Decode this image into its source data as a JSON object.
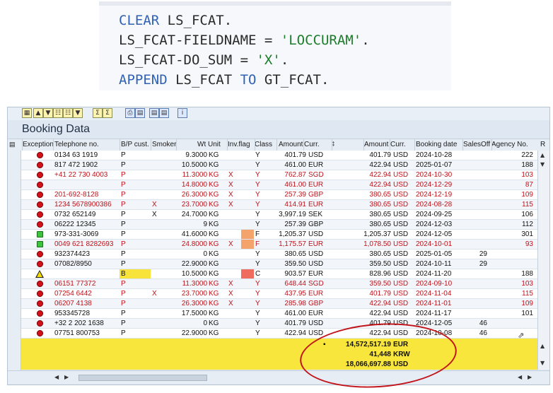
{
  "code": {
    "lines": [
      {
        "a": "CLEAR",
        "b": " LS_FCAT."
      },
      {
        "a": "LS_FCAT-FIELDNAME",
        "b": " = ",
        "c": "'LOCCURAM'",
        "d": "."
      },
      {
        "a": "LS_FCAT-DO_SUM",
        "b": " = ",
        "c": "'X'",
        "d": "."
      },
      {
        "a": "APPEND",
        "b": " LS_FCAT ",
        "c": "TO",
        "d": " GT_FCAT."
      }
    ]
  },
  "alv": {
    "title": "Booking Data",
    "toolbar_icons": [
      "details-icon",
      "sort-ascending-icon",
      "sort-descending-icon",
      "find-icon",
      "find-next-icon",
      "filter-icon",
      "sum-icon",
      "subtotal-icon",
      "print-icon",
      "views-icon",
      "export-icon",
      "layout-icon",
      "info-icon"
    ],
    "headers": [
      "Exception",
      "Telephone no.",
      "B/P cust.",
      "Smoker",
      "Wt Unit",
      "Inv.flag",
      "Class",
      "Amount",
      "Curr.",
      "Amount",
      "Curr.",
      "Booking date",
      "SalesOff",
      "Agency No.",
      "R"
    ],
    "rows": [
      {
        "exc": "red",
        "tel": "0134 63 1919",
        "bp": "P",
        "smk": "",
        "wt": "9.3000",
        "unit": "KG",
        "inv": "",
        "cls": "Y",
        "amt": "401.79",
        "cur": "USD",
        "lamt": "401.79",
        "lcur": "USD",
        "date": "2024-10-28",
        "so": "",
        "ag": "222",
        "red": false
      },
      {
        "exc": "red",
        "tel": "817 472 1902",
        "bp": "P",
        "smk": "",
        "wt": "10.5000",
        "unit": "KG",
        "inv": "",
        "cls": "Y",
        "amt": "461.00",
        "cur": "EUR",
        "lamt": "422.94",
        "lcur": "USD",
        "date": "2025-01-07",
        "so": "",
        "ag": "188",
        "red": false
      },
      {
        "exc": "red",
        "tel": "+41 22 730 4003",
        "bp": "P",
        "smk": "",
        "wt": "11.3000",
        "unit": "KG",
        "inv": "X",
        "cls": "Y",
        "amt": "762.87",
        "cur": "SGD",
        "lamt": "422.94",
        "lcur": "USD",
        "date": "2024-10-30",
        "so": "",
        "ag": "103",
        "red": true
      },
      {
        "exc": "red",
        "tel": "",
        "bp": "P",
        "smk": "",
        "wt": "14.8000",
        "unit": "KG",
        "inv": "X",
        "cls": "Y",
        "amt": "461.00",
        "cur": "EUR",
        "lamt": "422.94",
        "lcur": "USD",
        "date": "2024-12-29",
        "so": "",
        "ag": "87",
        "red": true
      },
      {
        "exc": "red",
        "tel": "201-692-8128",
        "bp": "P",
        "smk": "",
        "wt": "26.3000",
        "unit": "KG",
        "inv": "X",
        "cls": "Y",
        "amt": "257.39",
        "cur": "GBP",
        "lamt": "380.65",
        "lcur": "USD",
        "date": "2024-12-19",
        "so": "",
        "ag": "109",
        "red": true
      },
      {
        "exc": "red",
        "tel": "1234 5678900386",
        "bp": "P",
        "smk": "X",
        "wt": "23.7000",
        "unit": "KG",
        "inv": "X",
        "cls": "Y",
        "amt": "414.91",
        "cur": "EUR",
        "lamt": "380.65",
        "lcur": "USD",
        "date": "2024-08-28",
        "so": "",
        "ag": "115",
        "red": true
      },
      {
        "exc": "red",
        "tel": "0732 652149",
        "bp": "P",
        "smk": "X",
        "wt": "24.7000",
        "unit": "KG",
        "inv": "",
        "cls": "Y",
        "amt": "3,997.19",
        "cur": "SEK",
        "lamt": "380.65",
        "lcur": "USD",
        "date": "2024-09-25",
        "so": "",
        "ag": "106",
        "red": false
      },
      {
        "exc": "red",
        "tel": "06222 12345",
        "bp": "P",
        "smk": "",
        "wt": "9",
        "unit": "KG",
        "inv": "",
        "cls": "Y",
        "amt": "257.39",
        "cur": "GBP",
        "lamt": "380.65",
        "lcur": "USD",
        "date": "2024-12-03",
        "so": "",
        "ag": "112",
        "red": false
      },
      {
        "exc": "green",
        "tel": "973-331-3069",
        "bp": "P",
        "smk": "",
        "wt": "41.6000",
        "unit": "KG",
        "inv": "",
        "cls": "F",
        "amt": "1,205.37",
        "cur": "USD",
        "lamt": "1,205.37",
        "lcur": "USD",
        "date": "2024-12-05",
        "so": "",
        "ag": "301",
        "red": false,
        "clsbg": "#f4a46a"
      },
      {
        "exc": "green",
        "tel": "0049 621 8282693",
        "bp": "P",
        "smk": "",
        "wt": "24.8000",
        "unit": "KG",
        "inv": "X",
        "cls": "F",
        "amt": "1,175.57",
        "cur": "EUR",
        "lamt": "1,078.50",
        "lcur": "USD",
        "date": "2024-10-01",
        "so": "",
        "ag": "93",
        "red": true,
        "clsbg": "#f4a46a"
      },
      {
        "exc": "red",
        "tel": "932374423",
        "bp": "P",
        "smk": "",
        "wt": "0",
        "unit": "KG",
        "inv": "",
        "cls": "Y",
        "amt": "380.65",
        "cur": "USD",
        "lamt": "380.65",
        "lcur": "USD",
        "date": "2025-01-05",
        "so": "29",
        "ag": "",
        "red": false
      },
      {
        "exc": "red",
        "tel": "07082/8950",
        "bp": "P",
        "smk": "",
        "wt": "22.9000",
        "unit": "KG",
        "inv": "",
        "cls": "Y",
        "amt": "359.50",
        "cur": "USD",
        "lamt": "359.50",
        "lcur": "USD",
        "date": "2024-10-11",
        "so": "29",
        "ag": "",
        "red": false
      },
      {
        "exc": "warn",
        "tel": "",
        "bp": "B",
        "smk": "",
        "wt": "10.5000",
        "unit": "KG",
        "inv": "",
        "cls": "C",
        "amt": "903.57",
        "cur": "EUR",
        "lamt": "828.96",
        "lcur": "USD",
        "date": "2024-11-20",
        "so": "",
        "ag": "188",
        "red": false,
        "bpbg": "#f7e33a",
        "clsbg": "#f06c5e"
      },
      {
        "exc": "red",
        "tel": "06151 77372",
        "bp": "P",
        "smk": "",
        "wt": "11.3000",
        "unit": "KG",
        "inv": "X",
        "cls": "Y",
        "amt": "648.44",
        "cur": "SGD",
        "lamt": "359.50",
        "lcur": "USD",
        "date": "2024-09-10",
        "so": "",
        "ag": "103",
        "red": true
      },
      {
        "exc": "red",
        "tel": "07254 6442",
        "bp": "P",
        "smk": "X",
        "wt": "23.7000",
        "unit": "KG",
        "inv": "X",
        "cls": "Y",
        "amt": "437.95",
        "cur": "EUR",
        "lamt": "401.79",
        "lcur": "USD",
        "date": "2024-11-04",
        "so": "",
        "ag": "115",
        "red": true
      },
      {
        "exc": "red",
        "tel": "06207 4138",
        "bp": "P",
        "smk": "",
        "wt": "26.3000",
        "unit": "KG",
        "inv": "X",
        "cls": "Y",
        "amt": "285.98",
        "cur": "GBP",
        "lamt": "422.94",
        "lcur": "USD",
        "date": "2024-11-01",
        "so": "",
        "ag": "109",
        "red": true
      },
      {
        "exc": "red",
        "tel": "953345728",
        "bp": "P",
        "smk": "",
        "wt": "17.5000",
        "unit": "KG",
        "inv": "",
        "cls": "Y",
        "amt": "461.00",
        "cur": "EUR",
        "lamt": "422.94",
        "lcur": "USD",
        "date": "2024-11-17",
        "so": "",
        "ag": "101",
        "red": false
      },
      {
        "exc": "red",
        "tel": "+32 2 202 1638",
        "bp": "P",
        "smk": "",
        "wt": "0",
        "unit": "KG",
        "inv": "",
        "cls": "Y",
        "amt": "401.79",
        "cur": "USD",
        "lamt": "401.79",
        "lcur": "USD",
        "date": "2024-12-05",
        "so": "46",
        "ag": "",
        "red": false
      },
      {
        "exc": "red",
        "tel": "07751 800753",
        "bp": "P",
        "smk": "",
        "wt": "22.9000",
        "unit": "KG",
        "inv": "",
        "cls": "Y",
        "amt": "422.94",
        "cur": "USD",
        "lamt": "422.94",
        "lcur": "USD",
        "date": "2024-10-08",
        "so": "46",
        "ag": "",
        "red": false
      }
    ],
    "totals": [
      {
        "marker": "▪",
        "value": "14,572,517.19",
        "cur": "EUR"
      },
      {
        "marker": "",
        "value": "41,448",
        "cur": "KRW"
      },
      {
        "marker": "",
        "value": "18,066,697.88",
        "cur": "USD"
      }
    ],
    "colors": {
      "header_bg": "#e6edf5",
      "totals_bg": "#f9e63c",
      "annotation_circle": "#c2141b",
      "critical_text": "#c0121a"
    }
  }
}
